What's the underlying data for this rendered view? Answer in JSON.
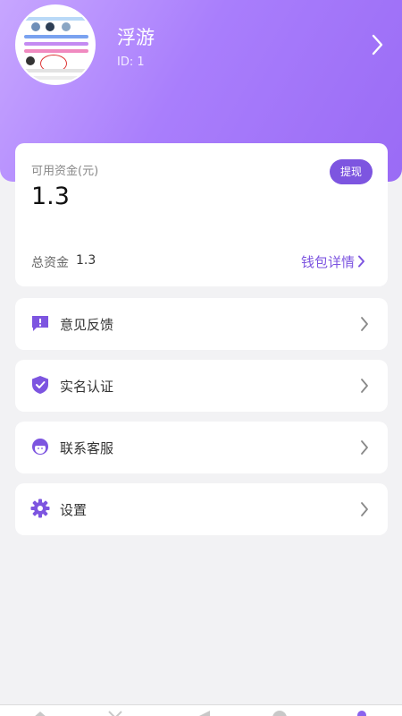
{
  "profile": {
    "name": "浮游",
    "id_text": "ID: 1",
    "avatar_icon": "user-avatar-screenshot",
    "arrow_icon": "chevron-right-icon"
  },
  "wallet": {
    "available_label": "可用资金(元)",
    "available_amount": "1.3",
    "withdraw_label": "提现",
    "total_label": "总资金",
    "total_value": "1.3",
    "detail_label": "钱包详情"
  },
  "menu": [
    {
      "label": "意见反馈",
      "icon": "feedback-icon"
    },
    {
      "label": "实名认证",
      "icon": "shield-check-icon"
    },
    {
      "label": "联系客服",
      "icon": "customer-service-icon"
    },
    {
      "label": "设置",
      "icon": "gear-icon"
    }
  ],
  "colors": {
    "accent": "#7d55e0",
    "header_gradient_start": "#c7a6ff",
    "header_gradient_end": "#9a6bf5",
    "background": "#f2f2f4"
  }
}
